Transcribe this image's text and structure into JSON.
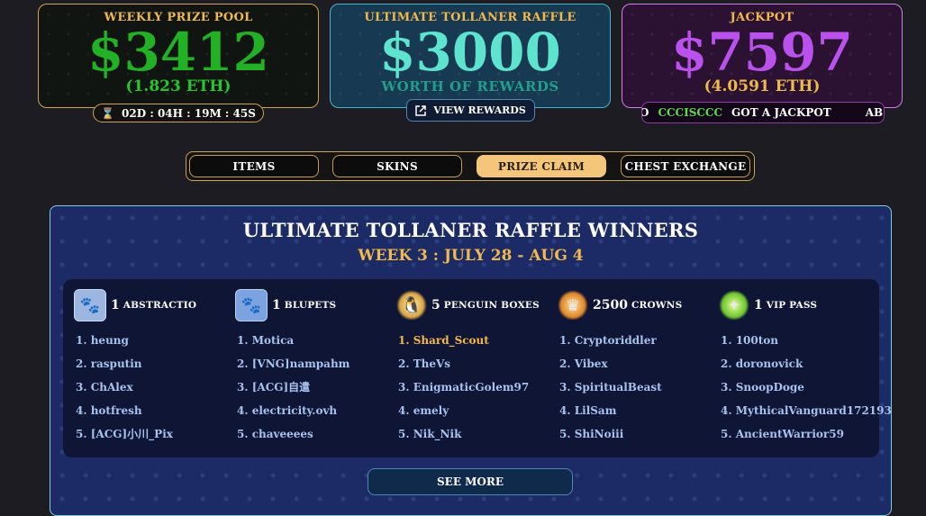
{
  "weekly_pool": {
    "title": "WEEKLY PRIZE POOL",
    "amount": "$3412",
    "eth": "(1.823 ETH)",
    "timer": "02D : 04H : 19M : 45S"
  },
  "raffle": {
    "title": "ULTIMATE TOLLANER RAFFLE",
    "amount": "$3000",
    "sub": "WORTH OF REWARDS",
    "button": "VIEW REWARDS"
  },
  "jackpot": {
    "title": "JACKPOT",
    "amount": "$7597",
    "eth": "(4.0591 ETH)",
    "ticker_lead": "O",
    "ticker_name": "CCCISCCC",
    "ticker_text": "GOT A JACKPOT",
    "ticker_tail": "ABO"
  },
  "tabs": [
    {
      "label": "ITEMS",
      "active": false
    },
    {
      "label": "SKINS",
      "active": false
    },
    {
      "label": "PRIZE CLAIM",
      "active": true
    },
    {
      "label": "CHEST EXCHANGE",
      "active": false
    }
  ],
  "winners_panel": {
    "title": "ULTIMATE TOLLANER RAFFLE WINNERS",
    "week": "WEEK 3 : JULY 28 - AUG 4",
    "see_more": "SEE MORE",
    "columns": [
      {
        "qty": "1",
        "prize": "ABSTRACTIO",
        "icon": "abstractio-icon",
        "winners": [
          "1. heung",
          "2. rasputin",
          "3. ChAlex",
          "4. hotfresh",
          "5. [ACG]小川_Pix"
        ]
      },
      {
        "qty": "1",
        "prize": "BLUPETS",
        "icon": "blupets-icon",
        "winners": [
          "1. Motica",
          "2. [VNG]nampahm",
          "3. [ACG]自遣",
          "4. electricity.ovh",
          "5. chaveeees"
        ]
      },
      {
        "qty": "5",
        "prize": "PENGUIN BOXES",
        "icon": "penguin-box-icon",
        "winners": [
          "1. Shard_Scout",
          "2. TheVs",
          "3. EnigmaticGolem97",
          "4. emely",
          "5. Nik_Nik"
        ]
      },
      {
        "qty": "2500",
        "prize": "CROWNS",
        "icon": "crowns-icon",
        "winners": [
          "1. Cryptoriddler",
          "2. Vibex",
          "3. SpiritualBeast",
          "4. LilSam",
          "5. ShiNoiii"
        ]
      },
      {
        "qty": "1",
        "prize": "VIP PASS",
        "icon": "vip-pass-icon",
        "winners": [
          "1. 100ton",
          "2. doronovick",
          "3. SnoopDoge",
          "4. MythicalVanguard172193",
          "5. AncientWarrior59"
        ]
      }
    ]
  }
}
